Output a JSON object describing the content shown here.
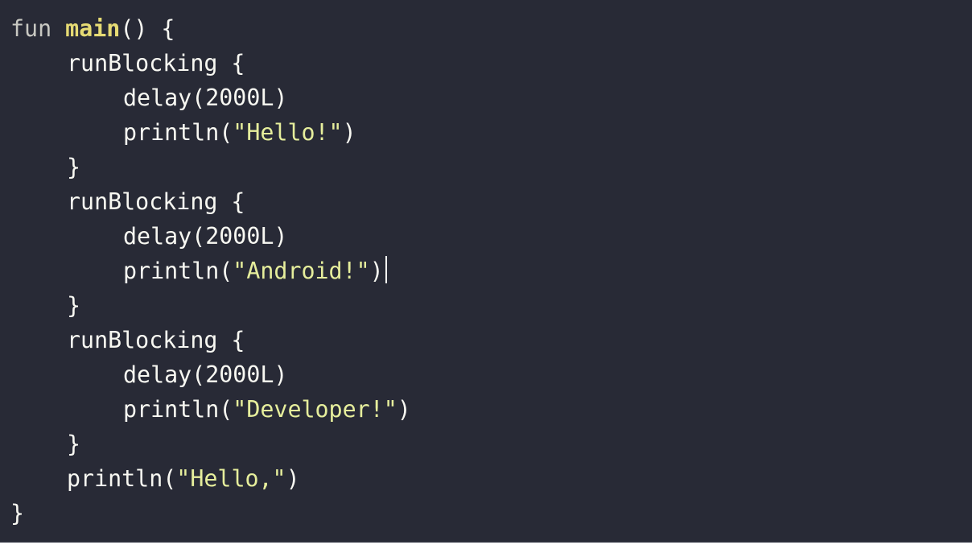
{
  "editor": {
    "lines": [
      {
        "indent": 0,
        "tokens": [
          {
            "type": "keyword",
            "text": "fun "
          },
          {
            "type": "funcname",
            "text": "main"
          },
          {
            "type": "plain",
            "text": "() {"
          }
        ]
      },
      {
        "indent": 1,
        "tokens": [
          {
            "type": "plain",
            "text": "runBlocking {"
          }
        ]
      },
      {
        "indent": 2,
        "tokens": [
          {
            "type": "plain",
            "text": "delay(2000L)"
          }
        ]
      },
      {
        "indent": 2,
        "tokens": [
          {
            "type": "plain",
            "text": "println("
          },
          {
            "type": "string",
            "text": "\"Hello!\""
          },
          {
            "type": "plain",
            "text": ")"
          }
        ]
      },
      {
        "indent": 1,
        "tokens": [
          {
            "type": "plain",
            "text": "}"
          }
        ]
      },
      {
        "indent": 1,
        "tokens": [
          {
            "type": "plain",
            "text": "runBlocking {"
          }
        ]
      },
      {
        "indent": 2,
        "tokens": [
          {
            "type": "plain",
            "text": "delay(2000L)"
          }
        ]
      },
      {
        "indent": 2,
        "tokens": [
          {
            "type": "plain",
            "text": "println("
          },
          {
            "type": "string",
            "text": "\"Android!\""
          },
          {
            "type": "plain",
            "text": ")"
          }
        ],
        "caret": true
      },
      {
        "indent": 1,
        "tokens": [
          {
            "type": "plain",
            "text": "}"
          }
        ]
      },
      {
        "indent": 1,
        "tokens": [
          {
            "type": "plain",
            "text": "runBlocking {"
          }
        ]
      },
      {
        "indent": 2,
        "tokens": [
          {
            "type": "plain",
            "text": "delay(2000L)"
          }
        ]
      },
      {
        "indent": 2,
        "tokens": [
          {
            "type": "plain",
            "text": "println("
          },
          {
            "type": "string",
            "text": "\"Developer!\""
          },
          {
            "type": "plain",
            "text": ")"
          }
        ]
      },
      {
        "indent": 1,
        "tokens": [
          {
            "type": "plain",
            "text": "}"
          }
        ]
      },
      {
        "indent": 1,
        "tokens": [
          {
            "type": "plain",
            "text": "println("
          },
          {
            "type": "string",
            "text": "\"Hello,\""
          },
          {
            "type": "plain",
            "text": ")"
          }
        ]
      },
      {
        "indent": 0,
        "tokens": [
          {
            "type": "plain",
            "text": "}"
          }
        ]
      }
    ]
  },
  "colors": {
    "background": "#282a36",
    "keyword": "#c8c8c2",
    "function_name": "#e6db74",
    "string": "#e6ee9c",
    "plain": "#f8f8f2"
  }
}
